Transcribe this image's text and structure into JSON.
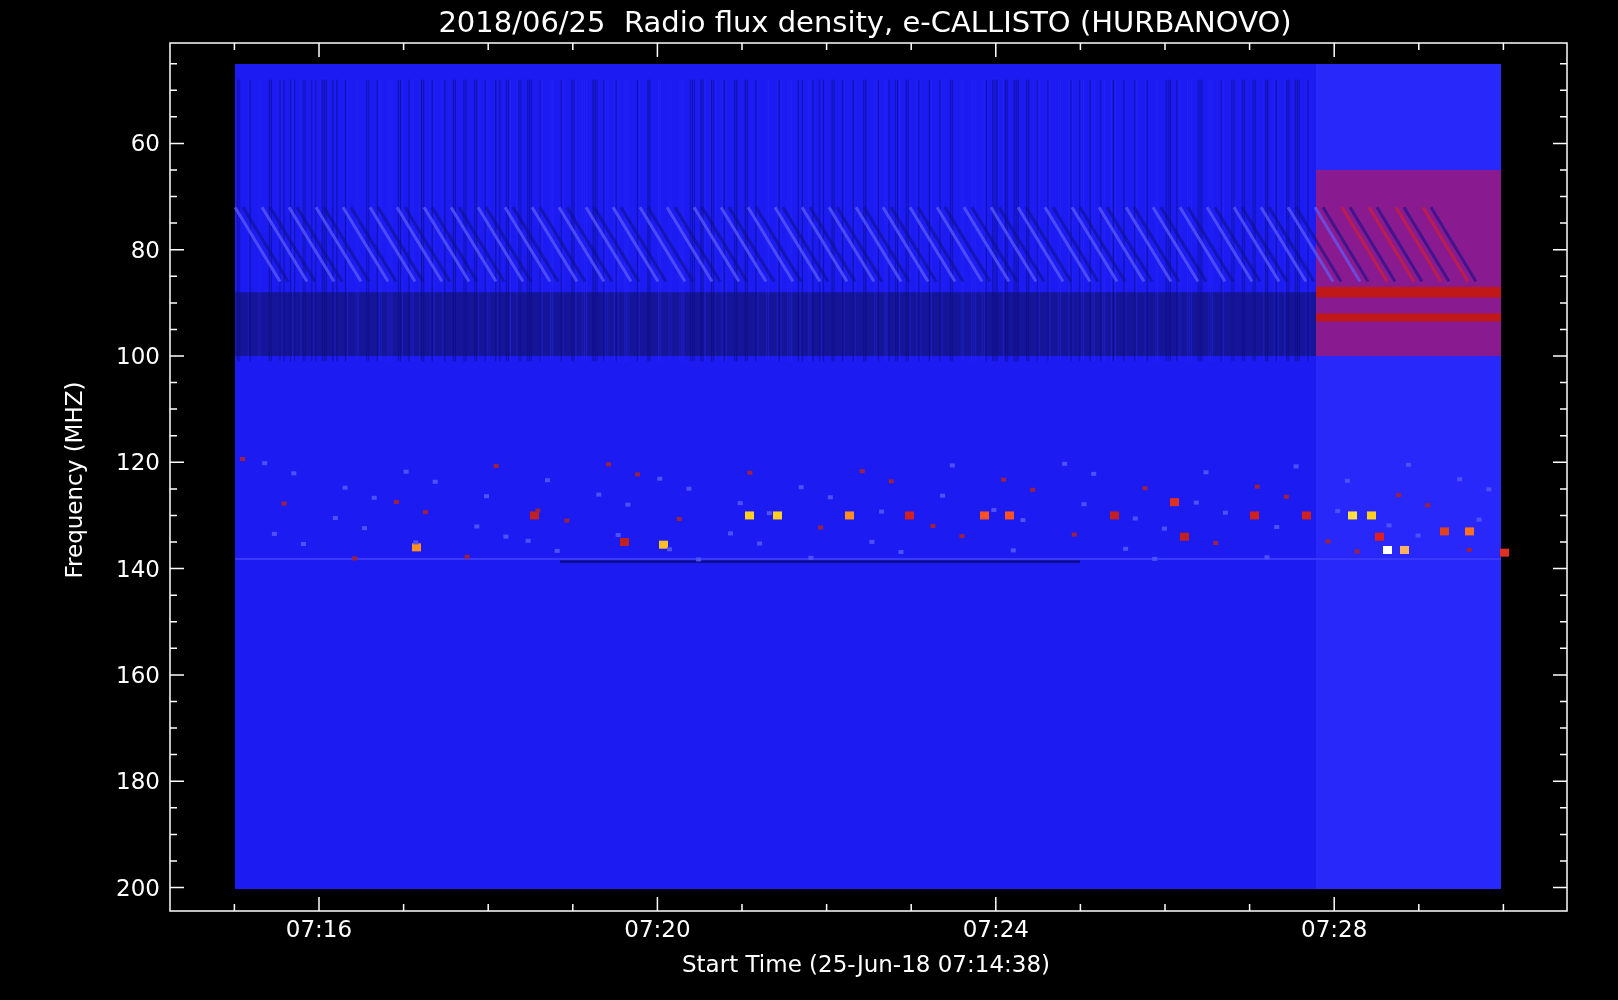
{
  "title": "2018/06/25  Radio flux density, e-CALLISTO (HURBANOVO)",
  "y_axis": {
    "label": "Frequency (MHZ)",
    "ticks": [
      "60",
      "80",
      "100",
      "120",
      "140",
      "160",
      "180",
      "200"
    ]
  },
  "x_axis": {
    "label": "Start Time (25-Jun-18 07:14:38)",
    "ticks": [
      "07:16",
      "07:20",
      "07:24",
      "07:28"
    ]
  }
}
